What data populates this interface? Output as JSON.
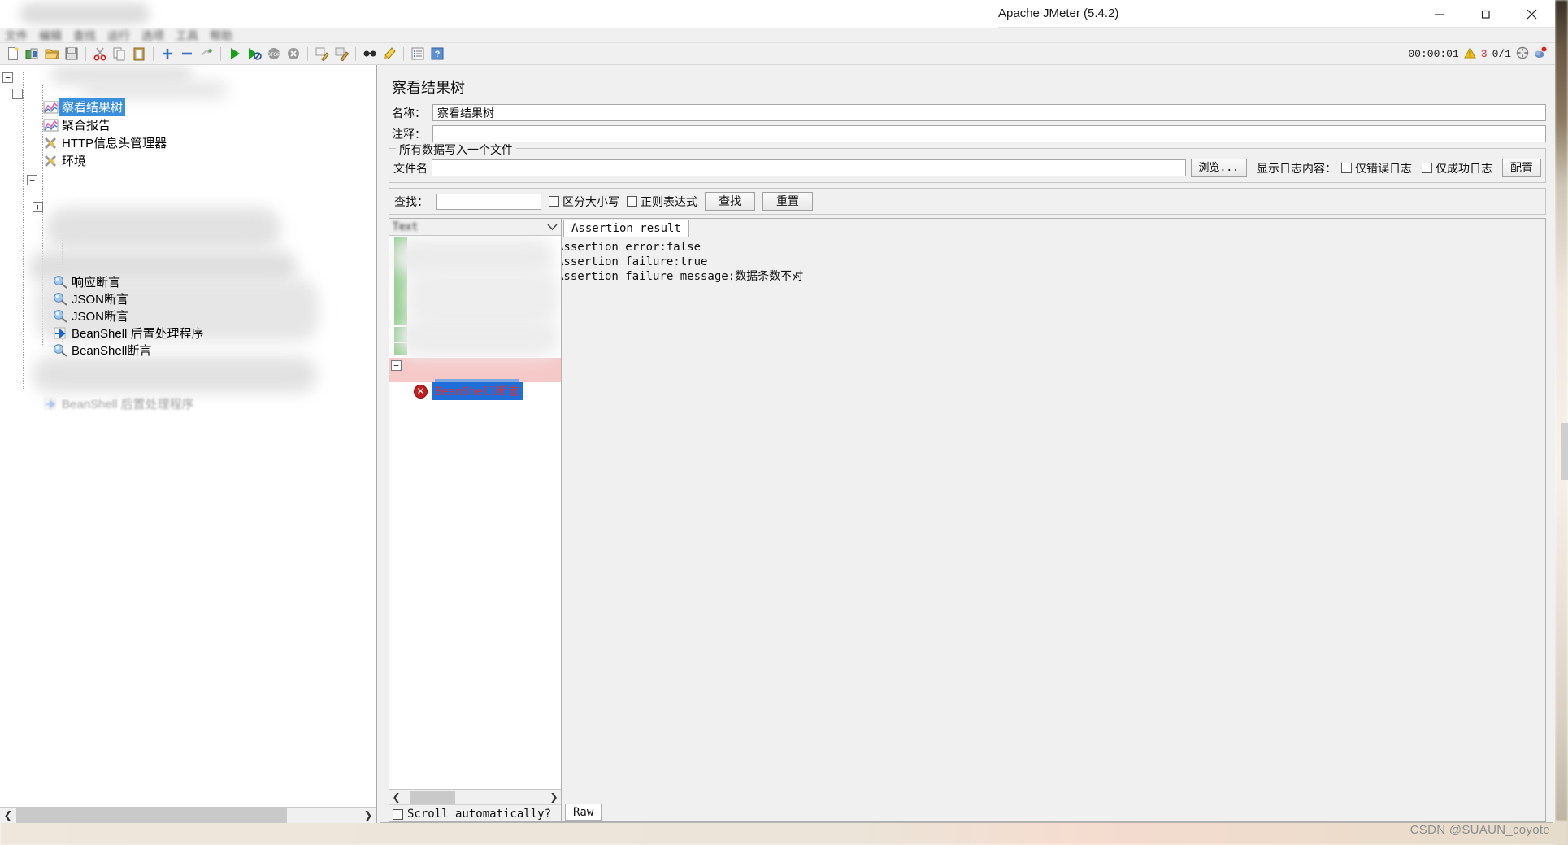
{
  "window": {
    "title": "Apache JMeter (5.4.2)",
    "minimize_label": "—",
    "maximize_label": "□",
    "close_label": "✕"
  },
  "menubar": {
    "items": [
      "文件",
      "编辑",
      "查找",
      "运行",
      "选项",
      "工具",
      "帮助"
    ]
  },
  "toolbar": {
    "icons": [
      "new-icon",
      "templates-icon",
      "open-icon",
      "save-icon",
      "cut-icon",
      "copy-icon",
      "paste-icon",
      "expand-icon",
      "collapse-icon",
      "toggle-icon",
      "start-icon",
      "start-no-pauses-icon",
      "stop-icon",
      "shutdown-icon",
      "clear-icon",
      "clear-all-icon",
      "search-icon",
      "search-reset-icon",
      "function-helper-icon",
      "help-icon"
    ]
  },
  "status": {
    "elapsed": "00:00:01",
    "warning_icon": "warning-triangle-icon",
    "warning_count": "3",
    "threads": "0/1",
    "connect_icon": "remote-icon",
    "notify_icon": "notification-icon"
  },
  "tree": {
    "items": [
      {
        "label": "察看结果树",
        "icon": "view-results-tree-icon",
        "selected": true
      },
      {
        "label": "聚合报告",
        "icon": "aggregate-report-icon",
        "selected": false
      },
      {
        "label": "HTTP信息头管理器",
        "icon": "header-manager-icon",
        "selected": false
      },
      {
        "label": "环境",
        "icon": "config-element-icon",
        "selected": false
      },
      {
        "label": "响应断言",
        "icon": "assertion-icon",
        "selected": false
      },
      {
        "label": "JSON断言",
        "icon": "assertion-icon",
        "selected": false
      },
      {
        "label": "JSON断言",
        "icon": "assertion-icon",
        "selected": false
      },
      {
        "label": "BeanShell 后置处理程序",
        "icon": "post-processor-icon",
        "selected": false
      },
      {
        "label": "BeanShell断言",
        "icon": "assertion-icon",
        "selected": false
      }
    ],
    "expand_collapse_glyphs": {
      "expanded": "−",
      "collapsed": "+"
    },
    "hscroll": {
      "left_arrow": "❮",
      "right_arrow": "❯"
    }
  },
  "panel": {
    "title": "察看结果树",
    "name_label": "名称：",
    "name_value": "察看结果树",
    "comment_label": "注释：",
    "comment_value": "",
    "file_group_legend": "所有数据写入一个文件",
    "filename_label": "文件名",
    "filename_value": "",
    "browse_button": "浏览...",
    "log_display_label": "显示日志内容：",
    "errors_only_label": "仅错误日志",
    "success_only_label": "仅成功日志",
    "configure_button": "配置"
  },
  "search": {
    "label": "查找：",
    "value": "",
    "case_sensitive_label": "区分大小写",
    "regex_label": "正则表达式",
    "find_button": "查找",
    "reset_button": "重置"
  },
  "results": {
    "renderer_selected": "Text",
    "chevron_icon": "chevron-down-icon",
    "selected_node_label": "BeanShell断言",
    "selected_node_icon": "error-circle-icon",
    "scroll_auto_label": "Scroll automatically?",
    "hscroll": {
      "left_arrow": "❮",
      "right_arrow": "❯"
    }
  },
  "assertion_panel": {
    "tab_label": "Assertion result",
    "lines": [
      "Assertion error:false",
      "Assertion failure:true",
      "Assertion failure message:数据条数不对"
    ],
    "bottom_tab_label": "Raw"
  },
  "watermark": "CSDN @SUAUN_coyote"
}
